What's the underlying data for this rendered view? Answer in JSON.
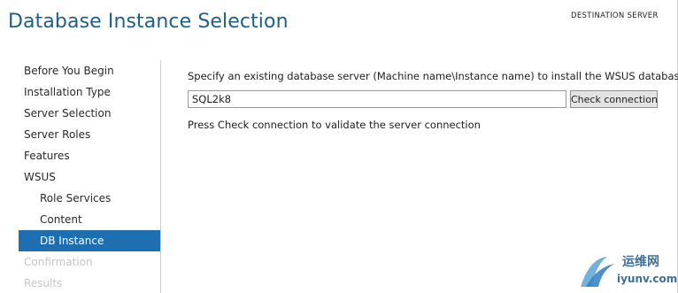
{
  "header": {
    "title": "Database Instance Selection",
    "destination_server_label": "DESTINATION SERVER"
  },
  "sidebar": {
    "items": [
      {
        "label": "Before You Begin",
        "state": "normal"
      },
      {
        "label": "Installation Type",
        "state": "normal"
      },
      {
        "label": "Server Selection",
        "state": "normal"
      },
      {
        "label": "Server Roles",
        "state": "normal"
      },
      {
        "label": "Features",
        "state": "normal"
      },
      {
        "label": "WSUS",
        "state": "normal"
      },
      {
        "label": "Role Services",
        "state": "normal"
      },
      {
        "label": "Content",
        "state": "normal"
      },
      {
        "label": "DB Instance",
        "state": "active"
      },
      {
        "label": "Confirmation",
        "state": "disabled"
      },
      {
        "label": "Results",
        "state": "disabled"
      }
    ]
  },
  "main": {
    "instruction": "Specify an existing database server (Machine name\\Instance name) to install the WSUS database:",
    "server_input_value": "SQL2k8",
    "check_button_label": "Check connection",
    "validate_message": "Press Check connection to validate the server connection"
  },
  "watermark": {
    "cn_text": "运维网",
    "en_text": "iyunv.com"
  },
  "colors": {
    "title": "#1f5f86",
    "active_nav_bg": "#1e6fb2",
    "disabled_text": "#c6c6c6"
  }
}
